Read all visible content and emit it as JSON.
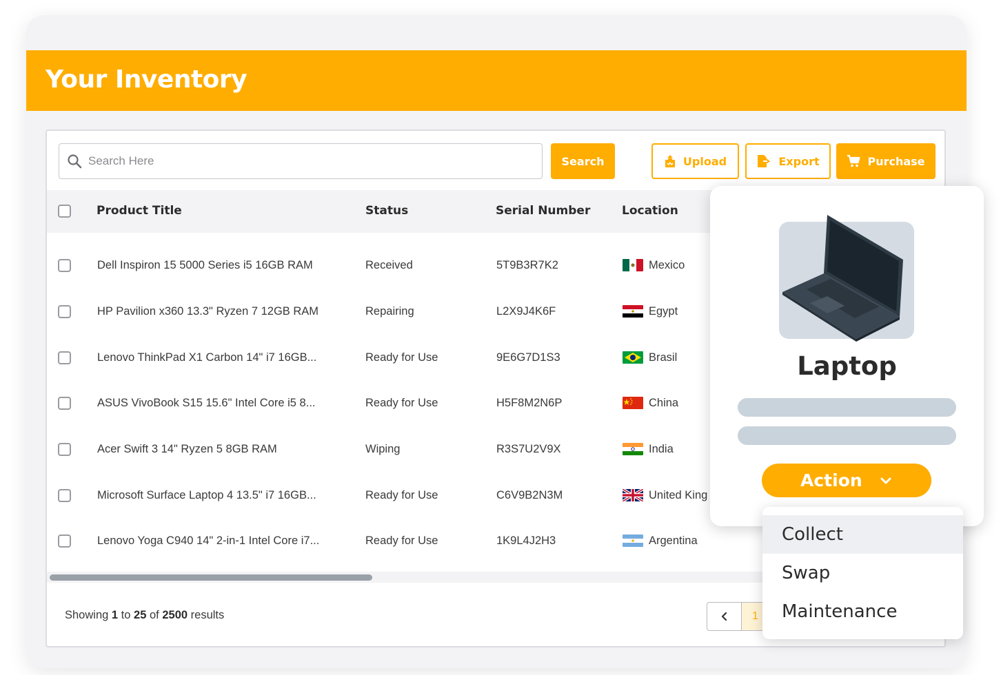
{
  "header": {
    "title": "Your Inventory"
  },
  "search": {
    "placeholder": "Search Here",
    "button_label": "Search"
  },
  "toolbar": {
    "upload_label": "Upload",
    "export_label": "Export",
    "purchase_label": "Purchase"
  },
  "table": {
    "columns": [
      "Product Title",
      "Status",
      "Serial Number",
      "Location"
    ],
    "rows": [
      {
        "title": "Dell Inspiron 15 5000 Series i5 16GB RAM",
        "status": "Received",
        "serial": "5T9B3R7K2",
        "location": "Mexico",
        "flag": "mexico-flag-icon"
      },
      {
        "title": "HP Pavilion x360 13.3\" Ryzen 7 12GB RAM",
        "status": "Repairing",
        "serial": "L2X9J4K6F",
        "location": "Egypt",
        "flag": "egypt-flag-icon"
      },
      {
        "title": "Lenovo ThinkPad X1 Carbon 14\" i7 16GB...",
        "status": "Ready for Use",
        "serial": "9E6G7D1S3",
        "location": "Brasil",
        "flag": "brazil-flag-icon"
      },
      {
        "title": "ASUS VivoBook S15 15.6\" Intel Core i5 8...",
        "status": "Ready for Use",
        "serial": "H5F8M2N6P",
        "location": "China",
        "flag": "china-flag-icon"
      },
      {
        "title": "Acer Swift 3 14\" Ryzen 5 8GB RAM",
        "status": "Wiping",
        "serial": "R3S7U2V9X",
        "location": "India",
        "flag": "india-flag-icon"
      },
      {
        "title": "Microsoft Surface Laptop 4 13.5\" i7 16GB...",
        "status": "Ready for Use",
        "serial": "C6V9B2N3M",
        "location": "United King",
        "flag": "uk-flag-icon"
      },
      {
        "title": "Lenovo Yoga C940 14\" 2-in-1 Intel Core i7...",
        "status": "Ready for Use",
        "serial": "1K9L4J2H3",
        "location": "Argentina",
        "flag": "argentina-flag-icon"
      }
    ]
  },
  "footer": {
    "showing_prefix": "Showing",
    "from": "1",
    "to_word": "to",
    "to": "25",
    "of_word": "of",
    "total": "2500",
    "results_word": "results",
    "current_page": "1"
  },
  "card": {
    "title": "Laptop",
    "action_label": "Action",
    "menu_items": [
      "Collect",
      "Swap",
      "Maintenance"
    ]
  },
  "colors": {
    "accent": "#ffad00",
    "header_bg": "#f3f3f5",
    "skeleton": "#c9d3dc"
  }
}
